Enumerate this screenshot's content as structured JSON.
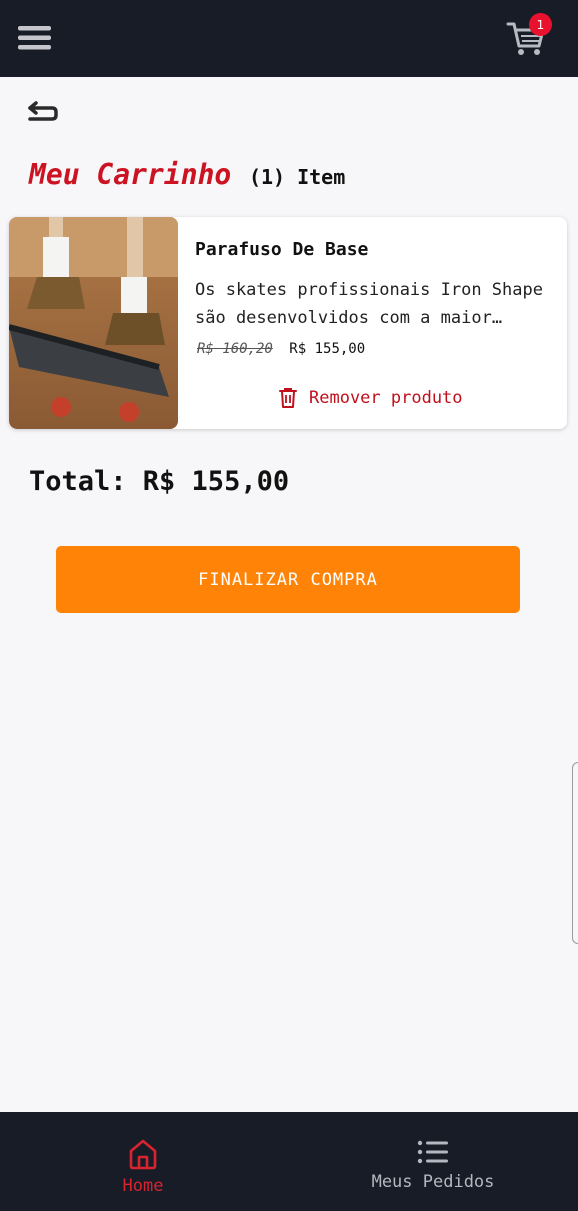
{
  "header": {
    "menu_icon": "hamburger-menu-icon",
    "cart_icon": "shopping-cart-icon",
    "cart_badge": "1"
  },
  "back_icon": "back-arrow-icon",
  "cart_page": {
    "title": "Meu Carrinho",
    "item_count": "(1) Item"
  },
  "items": [
    {
      "name": "Parafuso De Base",
      "description": "Os skates profissionais Iron Shape são desenvolvidos com a maior qualidade",
      "old_price": "R$ 160,20",
      "price": "R$ 155,00",
      "remove_label": "Remover produto",
      "remove_icon": "trash-icon",
      "image_icon": "skateboard-photo"
    }
  ],
  "total_label": "Total: R$ 155,00",
  "checkout_label": "FINALIZAR COMPRA",
  "bottom_nav": {
    "home_label": "Home",
    "home_icon": "home-icon",
    "orders_label": "Meus Pedidos",
    "orders_icon": "list-icon"
  },
  "colors": {
    "accent": "#cc1322",
    "checkout": "#ff8307",
    "nav_bg": "#181c27"
  }
}
